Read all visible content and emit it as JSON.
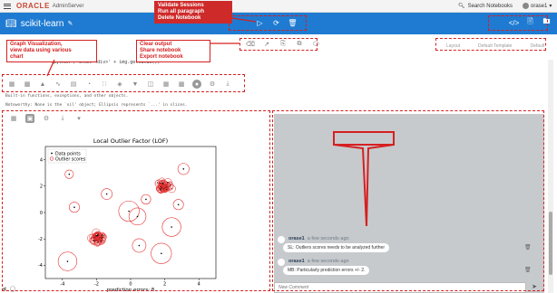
{
  "topbar": {
    "brand": "ORACLE",
    "product": "AdminServer",
    "search_label": "Search Notebooks",
    "user": "orase1"
  },
  "notebook": {
    "title": "scikit-learn"
  },
  "toolbar2": {
    "layout_label": "Layout",
    "template_label": "Default Template",
    "default_label": "Default"
  },
  "paragraph": {
    "code": "%python ('%html <div>' + img.getvalue())",
    "output_lines": [
      "Built-in functions, exceptions, and other objects.",
      "Noteworthy: None is the `nil' object; Ellipsis represents `...' in slices."
    ]
  },
  "annotations": {
    "validate": [
      "Validate Sessions",
      "Run all paragraph",
      "Delete Notebook"
    ],
    "graph": [
      "Graph Visualization,",
      "view data using various",
      "chart"
    ],
    "clear": [
      "Clear output",
      "Share notebook",
      "Export notebook"
    ]
  },
  "chart_data": {
    "type": "scatter",
    "title": "Local Outlier Factor (LOF)",
    "xlabel": "prediction errors: 8",
    "ylabel": "",
    "xlim": [
      -5,
      5
    ],
    "ylim": [
      -5,
      5
    ],
    "xticks": [
      -4,
      -2,
      0,
      2,
      4
    ],
    "yticks": [
      -4,
      -2,
      0,
      2,
      4
    ],
    "legend": {
      "position": "top-left",
      "entries": [
        "Data points",
        "Outlier scores"
      ]
    },
    "series": [
      {
        "name": "Data points",
        "color": "#000000"
      },
      {
        "name": "Outlier scores",
        "color": "#e53030"
      }
    ],
    "clusters": [
      {
        "cx": -1.9,
        "cy": -1.9,
        "n": 45,
        "spread": 0.32
      },
      {
        "cx": 2.0,
        "cy": 2.0,
        "n": 45,
        "spread": 0.32
      }
    ],
    "outliers": [
      {
        "x": -3.6,
        "y": 2.9,
        "r": 0.25
      },
      {
        "x": -3.3,
        "y": 0.4,
        "r": 0.3
      },
      {
        "x": -1.4,
        "y": 1.4,
        "r": 0.32
      },
      {
        "x": -0.1,
        "y": 0.1,
        "r": 0.6
      },
      {
        "x": 0.4,
        "y": -0.3,
        "r": 0.5
      },
      {
        "x": 0.9,
        "y": 1.0,
        "r": 0.28
      },
      {
        "x": 3.1,
        "y": 3.3,
        "r": 0.33
      },
      {
        "x": 2.4,
        "y": -1.1,
        "r": 0.55
      },
      {
        "x": 0.5,
        "y": -2.5,
        "r": 0.4
      },
      {
        "x": 1.8,
        "y": -3.1,
        "r": 0.6
      },
      {
        "x": -3.7,
        "y": -3.7,
        "r": 0.55
      },
      {
        "x": 2.8,
        "y": 0.6,
        "r": 0.3
      }
    ]
  },
  "comments": [
    {
      "user": "orase1",
      "time": "a few seconds ago",
      "text": "SL: Outliers scores needs to be analyzed further"
    },
    {
      "user": "orase1",
      "time": "a few seconds ago",
      "text": "MB: Particularly prediction errors +/- 2."
    }
  ],
  "comment_input": {
    "placeholder": "New Comment"
  }
}
